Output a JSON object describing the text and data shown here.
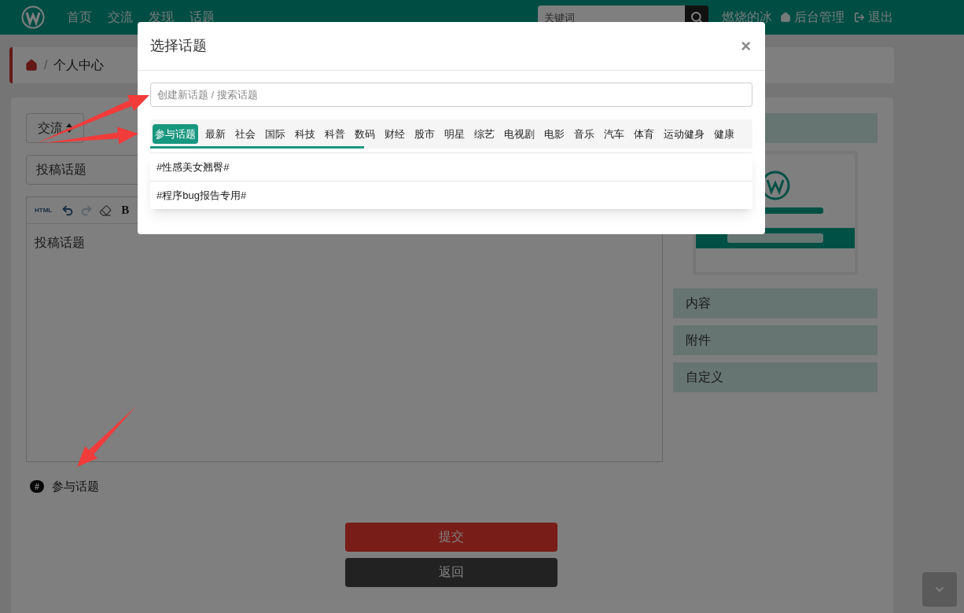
{
  "navbar": {
    "links": [
      "首页",
      "交流",
      "发现",
      "话题"
    ],
    "search": {
      "placeholder": "关键词"
    },
    "user": "燃烧的冰",
    "admin": "后台管理",
    "logout": "退出"
  },
  "breadcrumb": {
    "current": "个人中心",
    "separator": "/"
  },
  "form": {
    "category": "交流",
    "title_value": "投稿话题",
    "toolbar": [
      {
        "kind": "text",
        "label": "HTML",
        "disabled": false
      },
      {
        "kind": "undo",
        "disabled": false
      },
      {
        "kind": "redo",
        "disabled": true
      },
      {
        "kind": "eraser",
        "disabled": false
      },
      {
        "kind": "bold",
        "label": "B",
        "disabled": false
      }
    ],
    "editor_text": "投稿话题",
    "topic_badge": "#",
    "topic_link": "参与话题",
    "submit": "提交",
    "back": "返回"
  },
  "sidebar": {
    "picture": {
      "kind": "picture"
    },
    "items": [
      "内容",
      "附件",
      "自定义"
    ]
  },
  "modal": {
    "title": "选择话题",
    "close": "×",
    "search": {
      "placeholder": "创建新话题 / 搜索话题"
    },
    "tabs": [
      {
        "label": "参与话题",
        "selected": true
      },
      {
        "label": "最新",
        "selected": false
      },
      {
        "label": "社会",
        "selected": false
      },
      {
        "label": "国际",
        "selected": false
      },
      {
        "label": "科技",
        "selected": false
      },
      {
        "label": "科普",
        "selected": false
      },
      {
        "label": "数码",
        "selected": false
      },
      {
        "label": "财经",
        "selected": false
      },
      {
        "label": "股市",
        "selected": false
      },
      {
        "label": "明星",
        "selected": false
      },
      {
        "label": "综艺",
        "selected": false
      },
      {
        "label": "电视剧",
        "selected": false
      },
      {
        "label": "电影",
        "selected": false
      },
      {
        "label": "音乐",
        "selected": false
      },
      {
        "label": "汽车",
        "selected": false
      },
      {
        "label": "体育",
        "selected": false
      },
      {
        "label": "运动健身",
        "selected": false
      },
      {
        "label": "健康",
        "selected": false
      }
    ],
    "results": [
      "#性感美女翘臀#",
      "#程序bug报告专用#"
    ]
  }
}
